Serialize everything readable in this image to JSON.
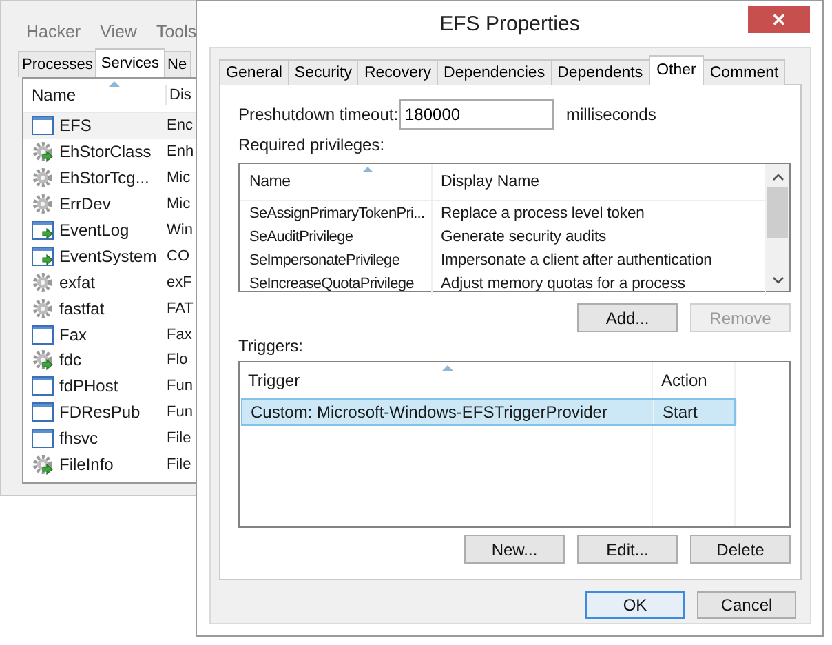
{
  "background_window": {
    "menu": [
      "Hacker",
      "View",
      "Tools"
    ],
    "tabs": [
      {
        "label": "Processes",
        "selected": false
      },
      {
        "label": "Services",
        "selected": true
      },
      {
        "label": "Ne",
        "selected": false
      }
    ],
    "columns": [
      "Name",
      "Dis"
    ],
    "services": [
      {
        "name": "EFS",
        "display": "Enc",
        "kind": "window",
        "running": false,
        "selected": true
      },
      {
        "name": "EhStorClass",
        "display": "Enh",
        "kind": "gear",
        "running": true,
        "selected": false
      },
      {
        "name": "EhStorTcg...",
        "display": "Mic",
        "kind": "gear",
        "running": false,
        "selected": false
      },
      {
        "name": "ErrDev",
        "display": "Mic",
        "kind": "gear",
        "running": false,
        "selected": false
      },
      {
        "name": "EventLog",
        "display": "Win",
        "kind": "window",
        "running": true,
        "selected": false
      },
      {
        "name": "EventSystem",
        "display": "CO",
        "kind": "window",
        "running": true,
        "selected": false
      },
      {
        "name": "exfat",
        "display": "exF",
        "kind": "gear",
        "running": false,
        "selected": false
      },
      {
        "name": "fastfat",
        "display": "FAT",
        "kind": "gear",
        "running": false,
        "selected": false
      },
      {
        "name": "Fax",
        "display": "Fax",
        "kind": "window",
        "running": false,
        "selected": false
      },
      {
        "name": "fdc",
        "display": "Flo",
        "kind": "gear",
        "running": true,
        "selected": false
      },
      {
        "name": "fdPHost",
        "display": "Fun",
        "kind": "window",
        "running": false,
        "selected": false
      },
      {
        "name": "FDResPub",
        "display": "Fun",
        "kind": "window",
        "running": false,
        "selected": false
      },
      {
        "name": "fhsvc",
        "display": "File",
        "kind": "window",
        "running": false,
        "selected": false
      },
      {
        "name": "FileInfo",
        "display": "File",
        "kind": "gear",
        "running": true,
        "selected": false
      }
    ]
  },
  "dialog": {
    "title": "EFS Properties",
    "close": "✕",
    "tabs": [
      {
        "label": "General",
        "selected": false
      },
      {
        "label": "Security",
        "selected": false
      },
      {
        "label": "Recovery",
        "selected": false
      },
      {
        "label": "Dependencies",
        "selected": false
      },
      {
        "label": "Dependents",
        "selected": false
      },
      {
        "label": "Other",
        "selected": true
      },
      {
        "label": "Comment",
        "selected": false
      }
    ],
    "preshutdown": {
      "label": "Preshutdown timeout:",
      "value": "180000",
      "unit": "milliseconds"
    },
    "privileges": {
      "label": "Required privileges:",
      "columns": [
        "Name",
        "Display Name"
      ],
      "rows": [
        [
          "SeAssignPrimaryTokenPri...",
          "Replace a process level token"
        ],
        [
          "SeAuditPrivilege",
          "Generate security audits"
        ],
        [
          "SeImpersonatePrivilege",
          "Impersonate a client after authentication"
        ],
        [
          "SeIncreaseQuotaPrivilege",
          "Adjust memory quotas for a process"
        ]
      ],
      "buttons": [
        {
          "label": "Add...",
          "disabled": false
        },
        {
          "label": "Remove",
          "disabled": true
        }
      ]
    },
    "triggers": {
      "label": "Triggers:",
      "columns": [
        "Trigger",
        "Action"
      ],
      "rows": [
        {
          "trigger": "Custom: Microsoft-Windows-EFSTriggerProvider",
          "action": "Start",
          "selected": true
        }
      ],
      "buttons": [
        "New...",
        "Edit...",
        "Delete"
      ]
    },
    "buttons": [
      {
        "label": "OK",
        "default": true
      },
      {
        "label": "Cancel",
        "default": false
      }
    ]
  }
}
